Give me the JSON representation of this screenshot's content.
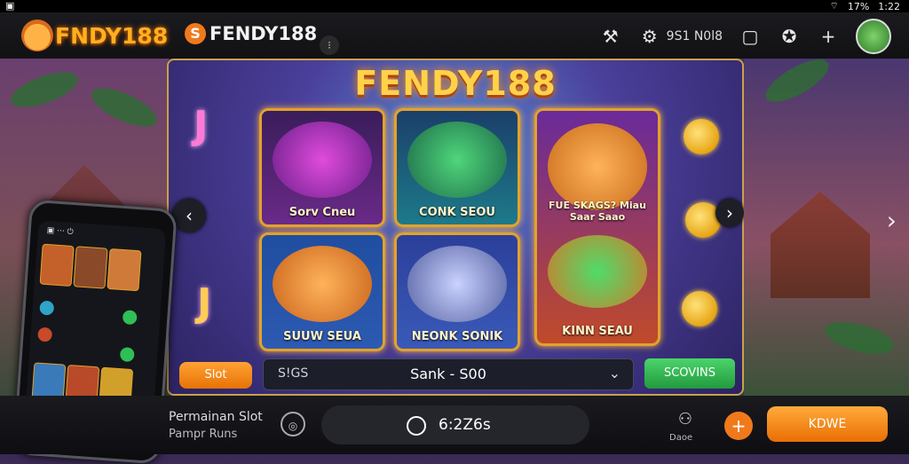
{
  "status_bar": {
    "left_icon": "notification-icon",
    "battery_text": "17%",
    "time": "1:22"
  },
  "header": {
    "logo_text": "FNDY188",
    "brand_text": "FENDY188",
    "brand_letter": "S",
    "account_label": "9S1 N0l8",
    "icons": [
      "gavel-icon",
      "gear-icon",
      "tablet-icon",
      "settings-icon",
      "plus-icon",
      "avatar"
    ]
  },
  "game_panel": {
    "title": "FENDY188",
    "tiles": [
      {
        "name": "Sorv Cneu",
        "color": "#7a2ea0"
      },
      {
        "name": "CONK SEOU",
        "color": "#1d7a8a"
      },
      {
        "name": "FUE SKAGS? Miau Saar Saao",
        "color": "#9a3ab8"
      },
      {
        "name": "SUUW SEUA",
        "color": "#2d5ab2"
      },
      {
        "name": "NEONK SONIK",
        "color": "#2b3f9a"
      },
      {
        "name": "KINN SEAU",
        "color": "#a0461e"
      }
    ],
    "slot_button": "Slot",
    "filter_label": "S!GS",
    "filter_value": "Sank - S00",
    "cta_green": "SCOVINS"
  },
  "bottom_bar": {
    "title": "Permainan Slot",
    "subtitle": "Pampr Runs",
    "time_value": "6:2Z6s",
    "share_label": "Daoe",
    "cta": "KDWE"
  },
  "colors": {
    "accent": "#f07a1b",
    "gold": "#ffd24a",
    "green": "#2fbf55"
  }
}
